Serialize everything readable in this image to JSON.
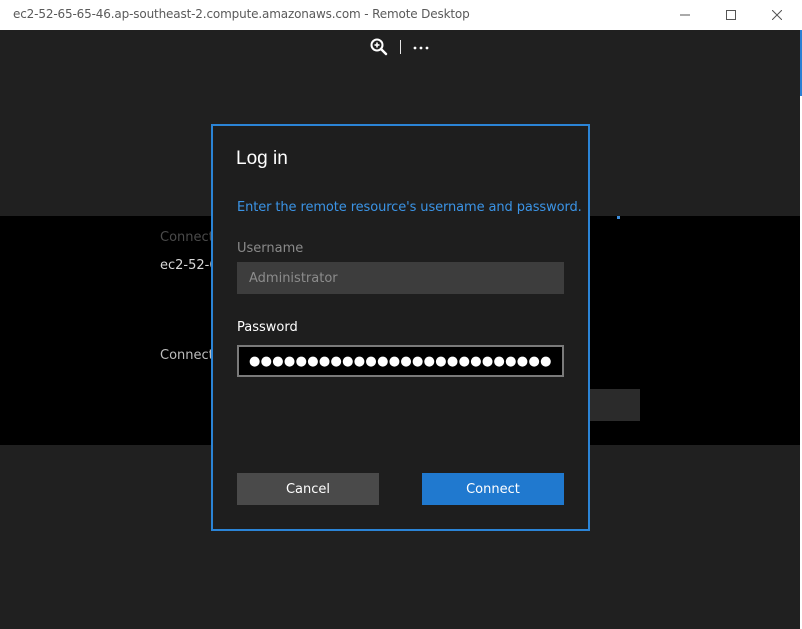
{
  "window": {
    "title": "ec2-52-65-65-46.ap-southeast-2.compute.amazonaws.com - Remote Desktop",
    "controls": {
      "minimize_icon": "minimize-icon",
      "maximize_icon": "maximize-icon",
      "close_icon": "close-icon"
    }
  },
  "toolbar": {
    "zoom_icon": "zoom-in-icon",
    "more_icon": "more-icon",
    "more_label": "···"
  },
  "background": {
    "connect_label_1": "Connect",
    "host": "ec2-52-6",
    "connect_label_2": "Connect"
  },
  "dialog": {
    "title": "Log in",
    "description": "Enter the remote resource's username and password.",
    "username_label": "Username",
    "username_value": "Administrator",
    "password_label": "Password",
    "password_value": "●●●●●●●●●●●●●●●●●●●●●●●●●●●●●●●●●",
    "cancel_label": "Cancel",
    "connect_label": "Connect"
  },
  "colors": {
    "accent": "#2b84d6",
    "connect_button": "#2079cf",
    "description_text": "#3b94e6",
    "dialog_bg": "#1e1e1e",
    "app_bg": "#202020"
  }
}
